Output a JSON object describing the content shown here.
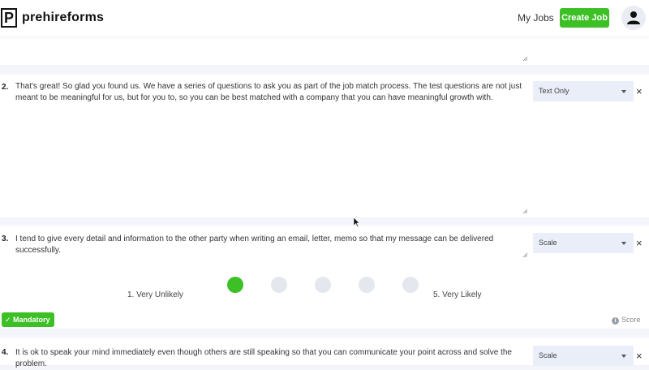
{
  "header": {
    "logo_letter": "P",
    "logo_text": "prehireforms",
    "nav_my_jobs": "My Jobs",
    "create_job": "Create Job",
    "avatar_icon": "person-icon"
  },
  "questions": [
    {
      "number": "2.",
      "text": "That's great! So glad you found us. We have a series of questions to ask you as part of the job match process. The test questions are not just meant to be meaningful for us, but for you to, so you can be best matched with a company that you can have meaningful growth with.",
      "type": "Text Only"
    },
    {
      "number": "3.",
      "text": "I tend to give every detail and information to the other party when writing an email, letter, memo so that my message can be delivered successfully.",
      "type": "Scale",
      "scale_min_label": "1. Very Unlikely",
      "scale_max_label": "5. Very Likely",
      "scale_selected": 1,
      "scale_points": 5,
      "mandatory_label": "✓ Mandatory",
      "score_label": "Score"
    },
    {
      "number": "4.",
      "text": "It is ok to speak your mind immediately even though others are still speaking so that you can communicate your point across and solve the problem.",
      "type": "Scale"
    }
  ],
  "icons": {
    "close": "×",
    "info": "i"
  },
  "colors": {
    "accent_green": "#3cc026",
    "page_bg": "#f3f5fb",
    "select_bg": "#e9eef8"
  }
}
